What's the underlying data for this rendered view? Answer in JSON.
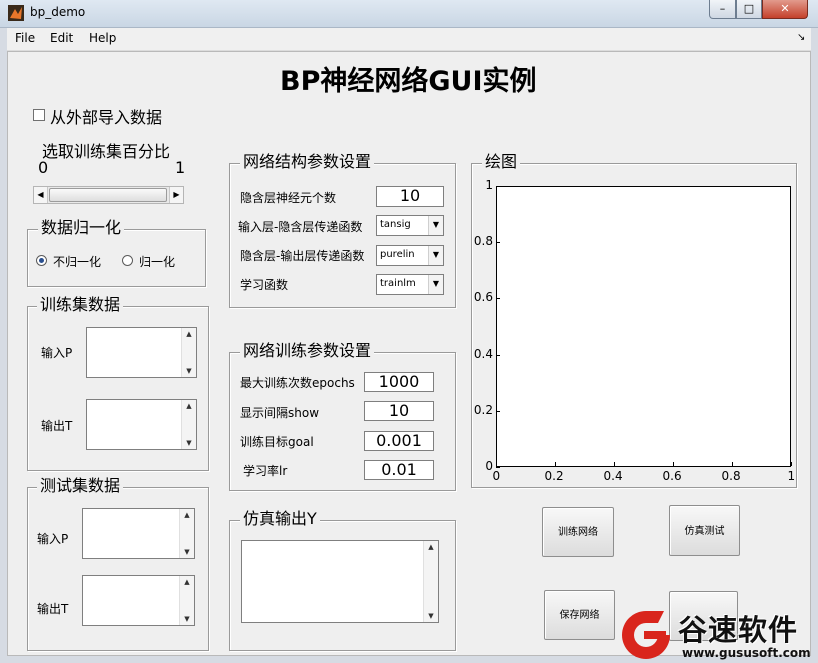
{
  "window": {
    "title": "bp_demo",
    "min": "–",
    "max": "□",
    "close": "✕"
  },
  "menu": {
    "file": "File",
    "edit": "Edit",
    "help": "Help",
    "arrow": "↘"
  },
  "title": "BP神经网络GUI实例",
  "import": {
    "label": "从外部导入数据",
    "checked": false
  },
  "split": {
    "label": "选取训练集百分比",
    "min_label": "0",
    "max_label": "1",
    "value": 0.0
  },
  "normalize": {
    "title": "数据归一化",
    "options": [
      {
        "label": "不归一化",
        "selected": true
      },
      {
        "label": "归一化",
        "selected": false
      }
    ]
  },
  "train_data": {
    "title": "训练集数据",
    "input_label": "输入P",
    "output_label": "输出T"
  },
  "test_data": {
    "title": "测试集数据",
    "input_label": "输入P",
    "output_label": "输出T"
  },
  "structure": {
    "title": "网络结构参数设置",
    "hidden_neurons_label": "隐含层神经元个数",
    "hidden_neurons_value": "10",
    "input_tf_label": "输入层-隐含层传递函数",
    "input_tf_value": "tansig",
    "output_tf_label": "隐含层-输出层传递函数",
    "output_tf_value": "purelin",
    "train_fn_label": "学习函数",
    "train_fn_value": "trainlm"
  },
  "training": {
    "title": "网络训练参数设置",
    "epochs_label": "最大训练次数epochs",
    "epochs_value": "1000",
    "show_label": "显示间隔show",
    "show_value": "10",
    "goal_label": "训练目标goal",
    "goal_value": "0.001",
    "lr_label": "学习率lr",
    "lr_value": "0.01"
  },
  "sim_output": {
    "title": "仿真输出Y"
  },
  "plot": {
    "title": "绘图",
    "x_ticks": [
      "0",
      "0.2",
      "0.4",
      "0.6",
      "0.8",
      "1"
    ],
    "y_ticks": [
      "0",
      "0.2",
      "0.4",
      "0.6",
      "0.8",
      "1"
    ]
  },
  "buttons": {
    "train": "训练网络",
    "sim_test": "仿真测试",
    "save": "保存网络",
    "load": ""
  },
  "watermark": {
    "brand": "谷速软件",
    "url": "www.gususoft.com"
  },
  "colors": {
    "background": "#efefef",
    "title_bar": "#c9d6e4",
    "close": "#c4412b",
    "watermark_red": "#d9251c"
  }
}
